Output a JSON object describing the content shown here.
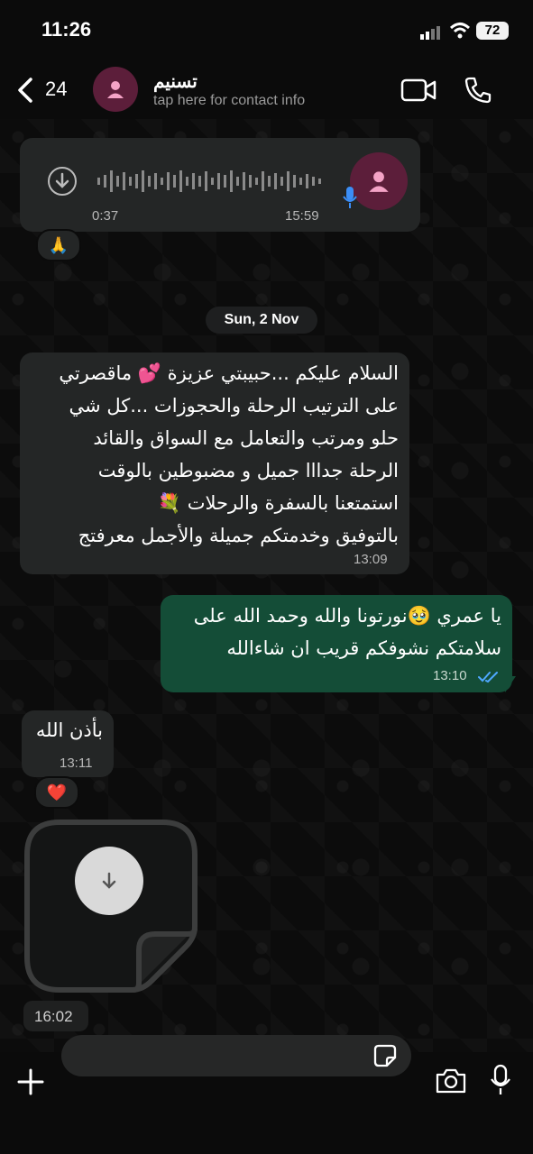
{
  "status_bar": {
    "time": "11:26",
    "battery": "72"
  },
  "header": {
    "back_count": "24",
    "contact_name": "تسنيم",
    "contact_subtitle": "tap here for contact info"
  },
  "messages": {
    "voice": {
      "duration": "0:37",
      "time": "15:59",
      "reaction": "🙏"
    },
    "date_chip": "Sun, 2 Nov",
    "incoming_long": {
      "lines": [
        "السلام عليكم ...حبيبتي عزيزة 💕 ماقصرتي",
        "على الترتيب الرحلة والحجوزات ...كل شي",
        "حلو ومرتب والتعامل مع السواق والقائد",
        "الرحلة جدااا جميل و مضبوطين بالوقت",
        "استمتعنا بالسفرة والرحلات 💐",
        "بالتوفيق وخدمتكم جميلة والأجمل معرفتج"
      ],
      "time": "13:09"
    },
    "outgoing": {
      "lines": [
        "يا عمري 🥹نورتونا والله وحمد الله على",
        "سلامتكم نشوفكم قريب ان شاءالله"
      ],
      "time": "13:10"
    },
    "incoming_short": {
      "text": "بأذن الله",
      "time": "13:11",
      "reaction": "❤️"
    },
    "sticker": {
      "time": "16:02"
    }
  },
  "colors": {
    "outgoing_bubble": "#144d37",
    "incoming_bubble": "#242626",
    "read_ticks": "#4fa8ff"
  }
}
